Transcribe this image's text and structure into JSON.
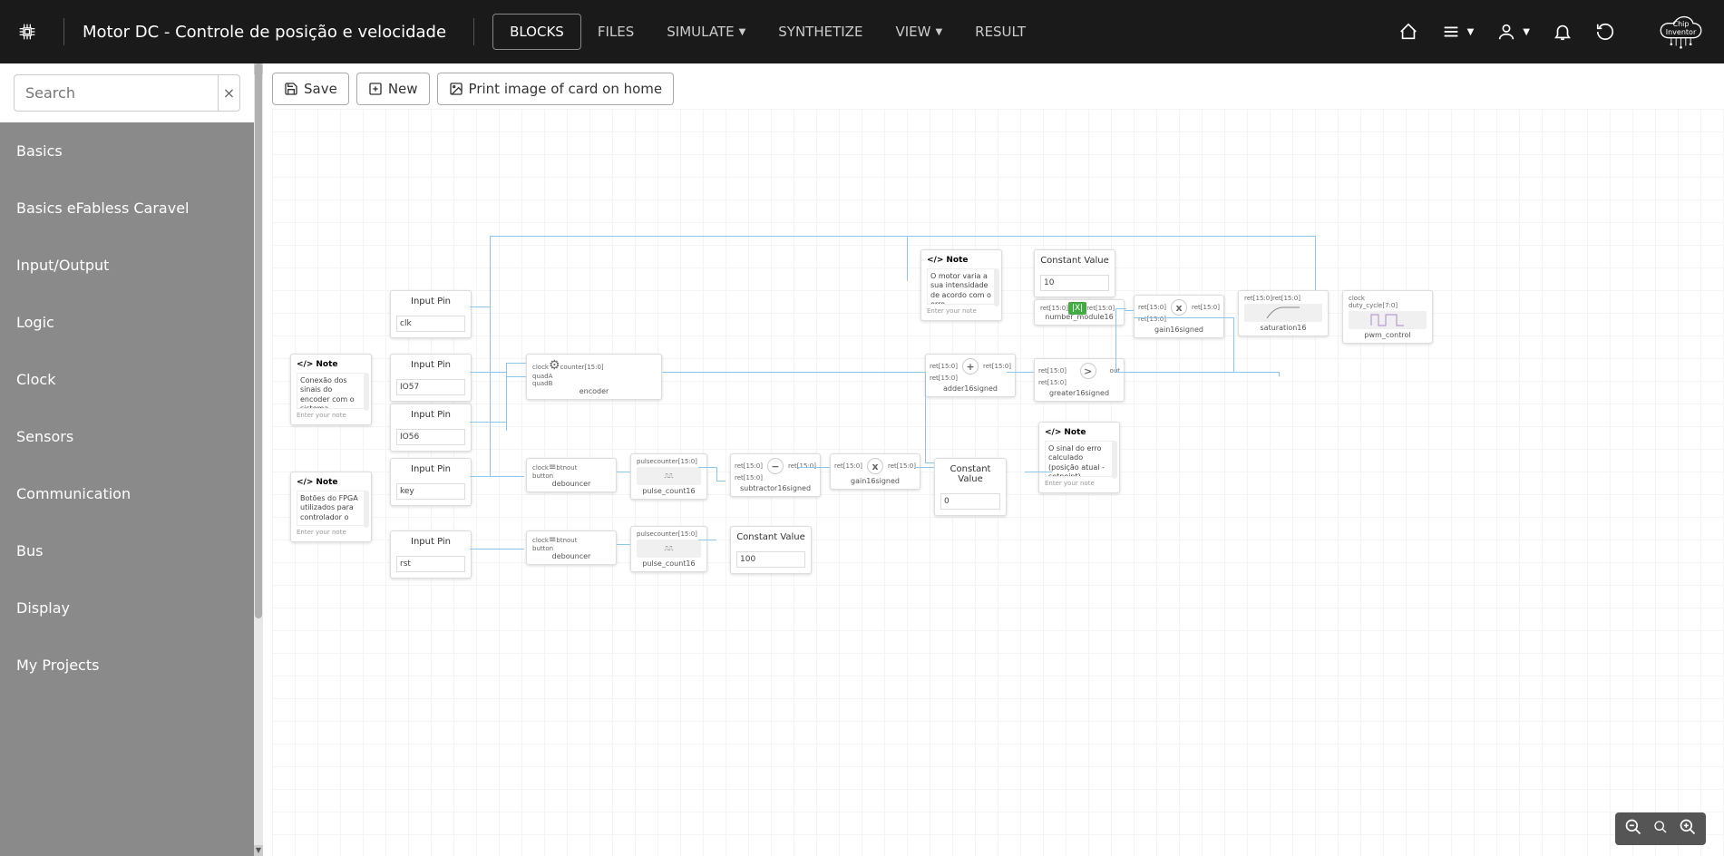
{
  "header": {
    "title": "Motor DC - Controle de posição e velocidade",
    "nav": {
      "blocks": "BLOCKS",
      "files": "FILES",
      "simulate": "SIMULATE",
      "synthetize": "SYNTHETIZE",
      "view": "VIEW",
      "result": "RESULT"
    },
    "logo_top": "Chip",
    "logo_bot": "Inventor"
  },
  "search": {
    "placeholder": "Search",
    "clear": "×"
  },
  "categories": [
    "Basics",
    "Basics eFabless Caravel",
    "Input/Output",
    "Logic",
    "Clock",
    "Sensors",
    "Communication",
    "Bus",
    "Display",
    "My Projects"
  ],
  "toolbar": {
    "save": "Save",
    "new": "New",
    "print": "Print image of card on home"
  },
  "nodes": {
    "inputpin_label": "Input Pin",
    "constant_label": "Constant Value",
    "pin1_val": "clk",
    "pin2_val": "IO57",
    "pin3_val": "IO56",
    "pin4_val": "key",
    "pin5_val": "rst",
    "const1_val": "10",
    "const2_val": "0",
    "const3_val": "100",
    "encoder": "encoder",
    "debouncer": "debouncer",
    "pulse_count": "pulse_count16",
    "subtractor": "subtractor16signed",
    "gain16signed": "gain16signed",
    "adder": "adder16signed",
    "greater": "greater16signed",
    "number_module": "number_module16",
    "saturation": "saturation16",
    "pwm": "pwm_control",
    "note_label": "Note",
    "enter_note": "Enter your note",
    "note1_text": "Conexão dos sinais do encoder com o sistema.",
    "note2_text": "Botões do FPGA utilizados para controlador o",
    "note3_text": "O motor varia a sua intensidade de acordo com o erro",
    "note4_text": "O sinal do erro calculado (posição atual - setpoint)",
    "port_clock": "clock",
    "port_quada": "quadA",
    "port_quadb": "quadB",
    "port_counter": "counter[15:0]",
    "port_pulse": "pulse",
    "port_button": "button",
    "port_btnout": "btnout",
    "port_ret": "ret[15:0]",
    "port_out": "out",
    "port_duty": "duty_cycle[7:0]"
  }
}
